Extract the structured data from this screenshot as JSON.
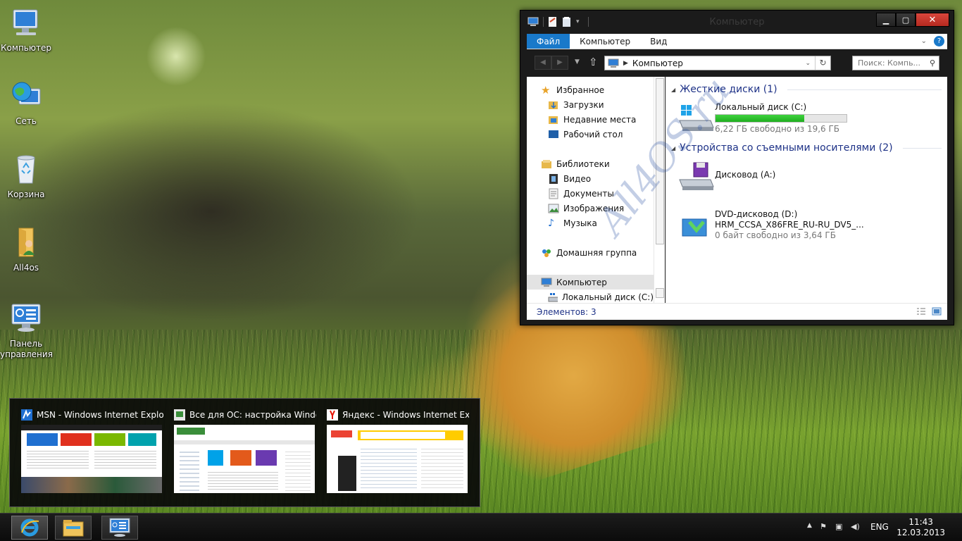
{
  "desktop": {
    "icons": [
      {
        "label": "Компьютер",
        "icon": "computer-icon"
      },
      {
        "label": "Сеть",
        "icon": "network-globe-icon"
      },
      {
        "label": "Корзина",
        "icon": "recycle-bin-icon"
      },
      {
        "label": "All4os",
        "icon": "user-folder-icon"
      },
      {
        "label": "Панель управления",
        "icon": "control-panel-icon"
      }
    ],
    "watermark": "All4OS.ru"
  },
  "explorer": {
    "title": "Компьютер",
    "ribbon_tabs": [
      "Файл",
      "Компьютер",
      "Вид"
    ],
    "address": "Компьютер",
    "search_placeholder": "Поиск: Компь...",
    "nav": {
      "favorites": "Избранное",
      "downloads": "Загрузки",
      "recent": "Недавние места",
      "desktop": "Рабочий стол",
      "libraries": "Библиотеки",
      "video": "Видео",
      "documents": "Документы",
      "images": "Изображения",
      "music": "Музыка",
      "homegroup": "Домашняя группа",
      "computer": "Компьютер",
      "local_disk": "Локальный диск (C:)"
    },
    "groups": {
      "hard_disks": "Жесткие диски (1)",
      "removable": "Устройства со съемными носителями (2)"
    },
    "drives": {
      "c": {
        "name": "Локальный диск (C:)",
        "free": "6,22 ГБ свободно из 19,6 ГБ",
        "used_fraction": 0.68
      },
      "a": {
        "name": "Дисковод (A:)"
      },
      "d": {
        "name": "DVD-дисковод (D:)",
        "label": "HRM_CCSA_X86FRE_RU-RU_DV5_...",
        "free": "0 байт свободно из 3,64 ГБ"
      }
    },
    "status": "Элементов: 3"
  },
  "thumbnails": [
    {
      "title": "MSN - Windows Internet Explorer",
      "icon": "msn-icon"
    },
    {
      "title": "Все для ОС: настройка Windo...",
      "icon": "all4os-icon"
    },
    {
      "title": "Яндекс - Windows Internet Expl...",
      "icon": "yandex-icon"
    }
  ],
  "taskbar": {
    "language": "ENG",
    "time": "11:43",
    "date": "12.03.2013"
  },
  "colors": {
    "accent": "#1979ca",
    "close": "#c7372c",
    "progress": "#2cc42c",
    "heading": "#1e3287"
  }
}
